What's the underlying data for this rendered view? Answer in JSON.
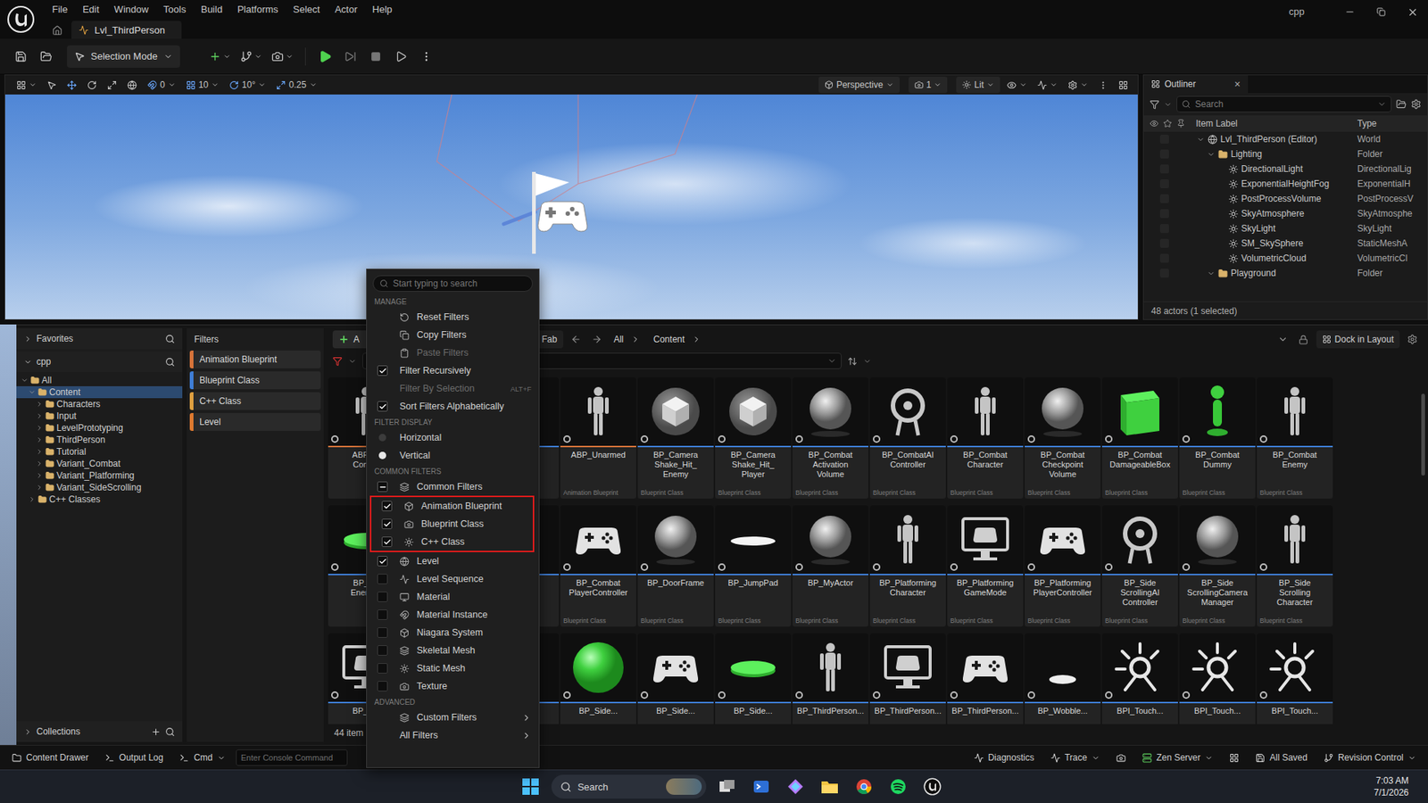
{
  "menubar": {
    "menus": [
      "File",
      "Edit",
      "Window",
      "Tools",
      "Build",
      "Platforms",
      "Select",
      "Actor",
      "Help"
    ],
    "project": "cpp",
    "tab": "Lvl_ThirdPerson"
  },
  "toolbar": {
    "mode": "Selection Mode"
  },
  "viewport": {
    "snaps": [
      "0",
      "10",
      "10°",
      "0.25"
    ],
    "view": "Perspective",
    "camera_speed": "1",
    "lighting": "Lit"
  },
  "outliner": {
    "title": "Outliner",
    "close": "×",
    "search": "Search",
    "columns": [
      "Item Label",
      "Type"
    ],
    "rows": [
      {
        "label": "Lvl_ThirdPerson (Editor)",
        "type": "World",
        "depth": 0,
        "kind": "world",
        "expanded": true,
        "selected": false
      },
      {
        "label": "Lighting",
        "type": "Folder",
        "depth": 1,
        "kind": "folder",
        "expanded": true,
        "selected": false
      },
      {
        "label": "DirectionalLight",
        "type": "DirectionalLig",
        "depth": 2,
        "kind": "actor",
        "expanded": false,
        "selected": false
      },
      {
        "label": "ExponentialHeightFog",
        "type": "ExponentialH",
        "depth": 2,
        "kind": "actor",
        "expanded": false,
        "selected": false
      },
      {
        "label": "PostProcessVolume",
        "type": "PostProcessV",
        "depth": 2,
        "kind": "actor",
        "expanded": false,
        "selected": false
      },
      {
        "label": "SkyAtmosphere",
        "type": "SkyAtmosphe",
        "depth": 2,
        "kind": "actor",
        "expanded": false,
        "selected": false
      },
      {
        "label": "SkyLight",
        "type": "SkyLight",
        "depth": 2,
        "kind": "actor",
        "expanded": false,
        "selected": false
      },
      {
        "label": "SM_SkySphere",
        "type": "StaticMeshA",
        "depth": 2,
        "kind": "actor",
        "expanded": false,
        "selected": false
      },
      {
        "label": "VolumetricCloud",
        "type": "VolumetricCl",
        "depth": 2,
        "kind": "actor",
        "expanded": false,
        "selected": false
      },
      {
        "label": "Playground",
        "type": "Folder",
        "depth": 1,
        "kind": "folder",
        "expanded": true,
        "selected": false
      }
    ],
    "footer": "48 actors (1 selected)"
  },
  "content_drawer": {
    "favorites": "Favorites",
    "project": "cpp",
    "tree": [
      {
        "label": "All",
        "depth": 0,
        "expanded": true,
        "selected": false
      },
      {
        "label": "Content",
        "depth": 1,
        "expanded": true,
        "selected": true
      },
      {
        "label": "Characters",
        "depth": 2,
        "expanded": false,
        "selected": false
      },
      {
        "label": "Input",
        "depth": 2,
        "expanded": false,
        "selected": false
      },
      {
        "label": "LevelPrototyping",
        "depth": 2,
        "expanded": false,
        "selected": false
      },
      {
        "label": "ThirdPerson",
        "depth": 2,
        "expanded": false,
        "selected": false
      },
      {
        "label": "Tutorial",
        "depth": 2,
        "expanded": false,
        "selected": false
      },
      {
        "label": "Variant_Combat",
        "depth": 2,
        "expanded": false,
        "selected": false
      },
      {
        "label": "Variant_Platforming",
        "depth": 2,
        "expanded": false,
        "selected": false
      },
      {
        "label": "Variant_SideScrolling",
        "depth": 2,
        "expanded": false,
        "selected": false
      },
      {
        "label": "C++ Classes",
        "depth": 1,
        "expanded": false,
        "selected": false
      }
    ],
    "collections": "Collections",
    "filters_title": "Filters",
    "active_filters": [
      {
        "label": "Animation Blueprint",
        "color": "#d8743a"
      },
      {
        "label": "Blueprint Class",
        "color": "#3f7fd8"
      },
      {
        "label": "C++ Class",
        "color": "#e0a040"
      },
      {
        "label": "Level",
        "color": "#e07a30"
      }
    ],
    "add": "A",
    "fab": "Fab",
    "breadcrumbs": [
      "All",
      "Content"
    ],
    "dock": "Dock in Layout",
    "count": "44 item",
    "tiles": [
      {
        "name": "ABP_M\nComba",
        "type": "",
        "kind": "mannequin",
        "color": "#d8743a"
      },
      {
        "name": "",
        "type": "",
        "kind": "blank",
        "color": "#3f7fd8"
      },
      {
        "name": "",
        "type": "",
        "kind": "blank",
        "color": "#3f7fd8"
      },
      {
        "name": "ABP_Unarmed",
        "type": "Animation Blueprint",
        "kind": "mannequin",
        "color": "#d8743a"
      },
      {
        "name": "BP_Camera\nShake_Hit_\nEnemy",
        "type": "Blueprint Class",
        "kind": "cube",
        "color": "#3f7fd8"
      },
      {
        "name": "BP_Camera\nShake_Hit_\nPlayer",
        "type": "Blueprint Class",
        "kind": "cube",
        "color": "#3f7fd8"
      },
      {
        "name": "BP_Combat\nActivation\nVolume",
        "type": "Blueprint Class",
        "kind": "sphere",
        "color": "#3f7fd8"
      },
      {
        "name": "BP_CombatAI\nController",
        "type": "Blueprint Class",
        "kind": "spot",
        "color": "#3f7fd8"
      },
      {
        "name": "BP_Combat\nCharacter",
        "type": "Blueprint Class",
        "kind": "mannequin",
        "color": "#3f7fd8"
      },
      {
        "name": "BP_Combat\nCheckpoint\nVolume",
        "type": "Blueprint Class",
        "kind": "sphere",
        "color": "#3f7fd8"
      },
      {
        "name": "BP_Combat\nDamageableBox",
        "type": "Blueprint Class",
        "kind": "greenbox",
        "color": "#3f7fd8"
      },
      {
        "name": "BP_Combat\nDummy",
        "type": "Blueprint Class",
        "kind": "greenpawn",
        "color": "#3f7fd8"
      },
      {
        "name": "BP_Combat\nEnemy",
        "type": "Blueprint Class",
        "kind": "mannequin",
        "color": "#3f7fd8"
      },
      {
        "name": "BP_Co\nEnemyS",
        "type": "",
        "kind": "greendisc",
        "color": "#3f7fd8"
      },
      {
        "name": "",
        "type": "",
        "kind": "blank",
        "color": "#3f7fd8"
      },
      {
        "name": "",
        "type": "",
        "kind": "blank",
        "color": "#3f7fd8"
      },
      {
        "name": "BP_Combat\nPlayerController",
        "type": "Blueprint Class",
        "kind": "gamepad",
        "color": "#3f7fd8"
      },
      {
        "name": "BP_DoorFrame",
        "type": "Blueprint Class",
        "kind": "sphere",
        "color": "#3f7fd8"
      },
      {
        "name": "BP_JumpPad",
        "type": "Blueprint Class",
        "kind": "disc",
        "color": "#3f7fd8"
      },
      {
        "name": "BP_MyActor",
        "type": "Blueprint Class",
        "kind": "sphere",
        "color": "#3f7fd8"
      },
      {
        "name": "BP_Platforming\nCharacter",
        "type": "Blueprint Class",
        "kind": "mannequin",
        "color": "#3f7fd8"
      },
      {
        "name": "BP_Platforming\nGameMode",
        "type": "Blueprint Class",
        "kind": "monitor",
        "color": "#3f7fd8"
      },
      {
        "name": "BP_Platforming\nPlayerController",
        "type": "Blueprint Class",
        "kind": "gamepad",
        "color": "#3f7fd8"
      },
      {
        "name": "BP_Side\nScrollingAI\nController",
        "type": "Blueprint Class",
        "kind": "spot",
        "color": "#3f7fd8"
      },
      {
        "name": "BP_Side\nScrollingCamera\nManager",
        "type": "Blueprint Class",
        "kind": "sphere",
        "color": "#3f7fd8"
      },
      {
        "name": "BP_Side\nScrolling\nCharacter",
        "type": "Blueprint Class",
        "kind": "mannequin",
        "color": "#3f7fd8"
      },
      {
        "name": "BP_Sid",
        "type": "",
        "kind": "monitor",
        "color": "#3f7fd8"
      },
      {
        "name": "",
        "type": "",
        "kind": "blank",
        "color": "#3f7fd8"
      },
      {
        "name": "",
        "type": "",
        "kind": "blank",
        "color": "#3f7fd8"
      },
      {
        "name": "BP_Side...",
        "type": "",
        "kind": "greensphere",
        "color": "#3f7fd8"
      },
      {
        "name": "BP_Side...",
        "type": "",
        "kind": "gamepad",
        "color": "#3f7fd8"
      },
      {
        "name": "BP_Side...",
        "type": "",
        "kind": "greendisc",
        "color": "#3f7fd8"
      },
      {
        "name": "BP_ThirdPerson...",
        "type": "",
        "kind": "mannequin",
        "color": "#3f7fd8"
      },
      {
        "name": "BP_ThirdPerson...",
        "type": "",
        "kind": "monitor",
        "color": "#3f7fd8"
      },
      {
        "name": "BP_ThirdPerson...",
        "type": "",
        "kind": "gamepad",
        "color": "#3f7fd8"
      },
      {
        "name": "BP_Wobble...",
        "type": "",
        "kind": "wobble",
        "color": "#3f7fd8"
      },
      {
        "name": "BPI_Touch...",
        "type": "",
        "kind": "gear",
        "color": "#3f7fd8"
      },
      {
        "name": "BPI_Touch...",
        "type": "",
        "kind": "gear",
        "color": "#3f7fd8"
      },
      {
        "name": "BPI_Touch...",
        "type": "",
        "kind": "gear",
        "color": "#3f7fd8"
      }
    ]
  },
  "filter_menu": {
    "search": "Start typing to search",
    "sections": [
      {
        "title": "MANAGE",
        "items": [
          {
            "label": "Reset Filters",
            "kind": "command",
            "has_icon": true,
            "checked": false,
            "disabled": false,
            "highlighted": false,
            "shortcut": ""
          },
          {
            "label": "Copy Filters",
            "kind": "command",
            "has_icon": true,
            "checked": false,
            "disabled": false,
            "highlighted": false,
            "shortcut": ""
          },
          {
            "label": "Paste Filters",
            "kind": "command",
            "has_icon": true,
            "checked": false,
            "disabled": true,
            "highlighted": false,
            "shortcut": ""
          },
          {
            "label": "Filter Recursively",
            "kind": "check",
            "has_icon": false,
            "checked": true,
            "disabled": false,
            "highlighted": false,
            "shortcut": ""
          },
          {
            "label": "Filter By Selection",
            "kind": "command",
            "has_icon": false,
            "checked": false,
            "disabled": true,
            "highlighted": false,
            "shortcut": "ALT+F"
          },
          {
            "label": "Sort Filters Alphabetically",
            "kind": "check",
            "has_icon": false,
            "checked": true,
            "disabled": false,
            "highlighted": false,
            "shortcut": ""
          }
        ]
      },
      {
        "title": "FILTER DISPLAY",
        "items": [
          {
            "label": "Horizontal",
            "kind": "radio",
            "has_icon": false,
            "checked": false,
            "disabled": false,
            "highlighted": false,
            "shortcut": ""
          },
          {
            "label": "Vertical",
            "kind": "radio",
            "has_icon": false,
            "checked": true,
            "disabled": false,
            "highlighted": false,
            "shortcut": ""
          }
        ]
      },
      {
        "title": "COMMON FILTERS",
        "items": [
          {
            "label": "Common Filters",
            "kind": "tristate",
            "has_icon": true,
            "checked": false,
            "disabled": false,
            "highlighted": false,
            "shortcut": ""
          },
          {
            "label": "Animation Blueprint",
            "kind": "check",
            "has_icon": true,
            "checked": true,
            "disabled": false,
            "highlighted": true,
            "shortcut": ""
          },
          {
            "label": "Blueprint Class",
            "kind": "check",
            "has_icon": true,
            "checked": true,
            "disabled": false,
            "highlighted": true,
            "shortcut": ""
          },
          {
            "label": "C++ Class",
            "kind": "check",
            "has_icon": true,
            "checked": true,
            "disabled": false,
            "highlighted": true,
            "shortcut": ""
          },
          {
            "label": "Level",
            "kind": "check",
            "has_icon": true,
            "checked": true,
            "disabled": false,
            "highlighted": false,
            "shortcut": ""
          },
          {
            "label": "Level Sequence",
            "kind": "check",
            "has_icon": true,
            "checked": false,
            "disabled": false,
            "highlighted": false,
            "shortcut": ""
          },
          {
            "label": "Material",
            "kind": "check",
            "has_icon": true,
            "checked": false,
            "disabled": false,
            "highlighted": false,
            "shortcut": ""
          },
          {
            "label": "Material Instance",
            "kind": "check",
            "has_icon": true,
            "checked": false,
            "disabled": false,
            "highlighted": false,
            "shortcut": ""
          },
          {
            "label": "Niagara System",
            "kind": "check",
            "has_icon": true,
            "checked": false,
            "disabled": false,
            "highlighted": false,
            "shortcut": ""
          },
          {
            "label": "Skeletal Mesh",
            "kind": "check",
            "has_icon": true,
            "checked": false,
            "disabled": false,
            "highlighted": false,
            "shortcut": ""
          },
          {
            "label": "Static Mesh",
            "kind": "check",
            "has_icon": true,
            "checked": false,
            "disabled": false,
            "highlighted": false,
            "shortcut": ""
          },
          {
            "label": "Texture",
            "kind": "check",
            "has_icon": true,
            "checked": false,
            "disabled": false,
            "highlighted": false,
            "shortcut": ""
          }
        ]
      },
      {
        "title": "ADVANCED",
        "items": [
          {
            "label": "Custom Filters",
            "kind": "submenu",
            "has_icon": true,
            "checked": false,
            "disabled": false,
            "highlighted": false,
            "shortcut": ""
          },
          {
            "label": "All Filters",
            "kind": "submenu",
            "has_icon": false,
            "checked": false,
            "disabled": false,
            "highlighted": false,
            "shortcut": ""
          }
        ]
      }
    ]
  },
  "status_bar": {
    "left": [
      "Content Drawer",
      "Output Log"
    ],
    "cmd": "Cmd",
    "console_placeholder": "Enter Console Command",
    "right": [
      "Diagnostics",
      "Trace",
      "Zen Server",
      "All Saved",
      "Revision Control"
    ]
  },
  "taskbar": {
    "search": "Search",
    "time": "7:03 AM",
    "date": "7/1/2026"
  }
}
